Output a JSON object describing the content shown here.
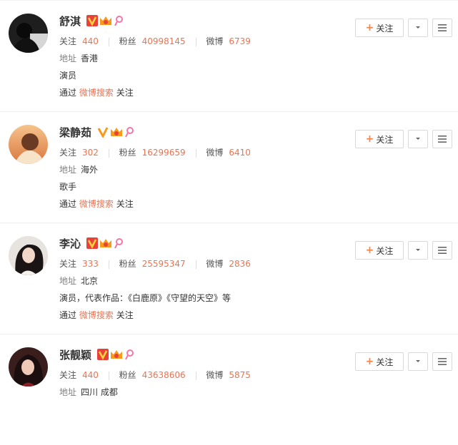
{
  "labels": {
    "follow_count": "关注",
    "fans_count": "粉丝",
    "weibo_count": "微博",
    "location": "地址",
    "via_prefix": "通过",
    "via_link": "微博搜索",
    "via_suffix": "关注",
    "follow_button": "关注"
  },
  "users": [
    {
      "name": "舒淇",
      "following": "440",
      "fans": "40998145",
      "weibo": "6739",
      "location": "香港",
      "intro": "演员"
    },
    {
      "name": "梁静茹",
      "following": "302",
      "fans": "16299659",
      "weibo": "6410",
      "location": "海外",
      "intro": "歌手"
    },
    {
      "name": "李沁",
      "following": "333",
      "fans": "25595347",
      "weibo": "2836",
      "location": "北京",
      "intro": "演员，代表作品：《白鹿原》《守望的天空》等"
    },
    {
      "name": "张靓颖",
      "following": "440",
      "fans": "43638606",
      "weibo": "5875",
      "location": "四川 成都",
      "intro": ""
    }
  ],
  "colors": {
    "accent": "#eb7350",
    "badge_orange": "#f79a1b",
    "badge_red": "#e8413a",
    "badge_pink": "#f277a8"
  },
  "icons": [
    "verified-v-icon",
    "crown-icon",
    "ribbon-icon",
    "plus-icon",
    "chevron-down-icon",
    "menu-icon"
  ]
}
